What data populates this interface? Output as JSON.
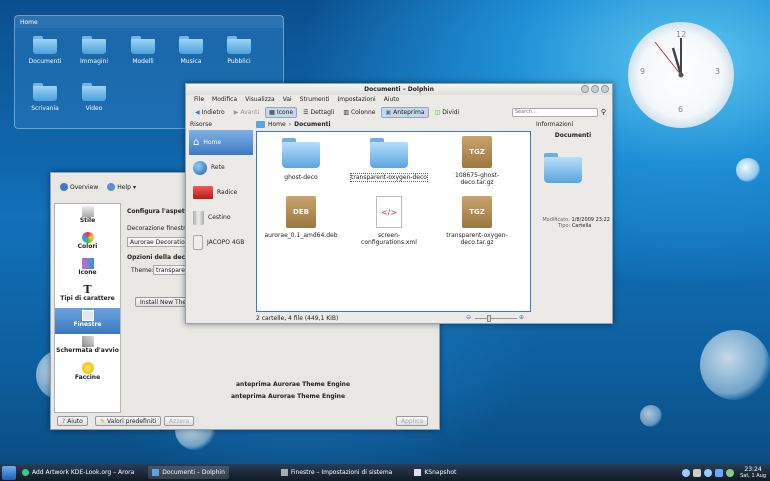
{
  "desktop": {
    "panel_title": "Home",
    "icons": [
      {
        "label": "Documenti"
      },
      {
        "label": "Immagini"
      },
      {
        "label": "Modelli"
      },
      {
        "label": "Musica"
      },
      {
        "label": "Pubblici"
      },
      {
        "label": "Scrivania"
      },
      {
        "label": "Video"
      }
    ]
  },
  "clock": {
    "numbers": [
      "12",
      "3",
      "6",
      "9"
    ]
  },
  "dolphin": {
    "title": "Documenti – Dolphin",
    "menu": [
      "File",
      "Modifica",
      "Visualizza",
      "Vai",
      "Strumenti",
      "Impostazioni",
      "Aiuto"
    ],
    "toolbar": {
      "back": "Indietro",
      "forward": "Avanti",
      "icons": "Icone",
      "details": "Dettagli",
      "columns": "Colonne",
      "preview": "Anteprima",
      "split": "Dividi",
      "search_placeholder": "Search..."
    },
    "places_title": "Risorse",
    "places": [
      {
        "label": "Home"
      },
      {
        "label": "Rete"
      },
      {
        "label": "Radice"
      },
      {
        "label": "Cestino"
      },
      {
        "label": "JACOPO 4GB"
      }
    ],
    "breadcrumb": [
      "Home",
      "Documenti"
    ],
    "files": [
      {
        "name": "ghost-deco",
        "kind": "folder"
      },
      {
        "name": "transparent-oxygen-deco",
        "kind": "folder"
      },
      {
        "name": "108675-ghost-deco.tar.gz",
        "kind": "TGZ"
      },
      {
        "name": "aurorae_0.1_amd64.deb",
        "kind": "DEB"
      },
      {
        "name": "screen-configurations.xml",
        "kind": "xml"
      },
      {
        "name": "transparent-oxygen-deco.tar.gz",
        "kind": "TGZ"
      }
    ],
    "status": "2 cartelle, 4 file (449,1 KiB)",
    "info": {
      "title": "Informazioni",
      "name": "Documenti",
      "modified_label": "Modificato:",
      "modified": "1/8/2009 23:22",
      "type_label": "Tipo:",
      "type": "Cartella"
    }
  },
  "settings": {
    "overview": "Overview",
    "help": "Help",
    "categories": [
      {
        "label": "Stile"
      },
      {
        "label": "Colori"
      },
      {
        "label": "Icone"
      },
      {
        "label": "Tipi di carattere"
      },
      {
        "label": "Finestre"
      },
      {
        "label": "Schermata d'avvio"
      },
      {
        "label": "Faccine"
      }
    ],
    "heading": "Configura l'aspetto e",
    "deco_label": "Decorazione finestra",
    "deco_value": "Aurorae Decoration Th",
    "options": "Opzioni della decora",
    "theme_label": "Theme:",
    "theme_value": "transparent-",
    "install": "Install New Theme",
    "preview1": "anteprima Aurorae Theme Engine",
    "preview2": "anteprima Aurorae Theme Engine",
    "btn_help": "Aiuto",
    "btn_defaults": "Valori predefiniti",
    "btn_reset": "Azzera",
    "btn_apply": "Applica"
  },
  "taskbar": {
    "tasks": [
      {
        "label": "Add Artwork KDE-Look.org – Arora"
      },
      {
        "label": "Documenti – Dolphin"
      },
      {
        "label": "Finestre – Impostazioni di sistema"
      },
      {
        "label": "KSnapshot"
      }
    ],
    "time": "23:24",
    "date": "Sat, 1 Aug"
  },
  "colors": {
    "accent": "#3d7ac4",
    "taskbar": "#1a2a3c"
  }
}
